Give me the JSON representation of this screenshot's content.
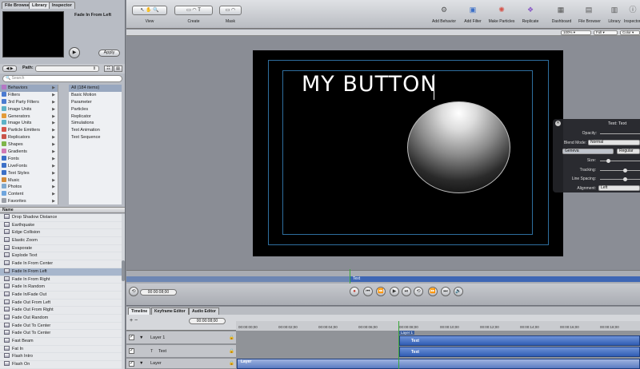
{
  "left_panel": {
    "tabs": [
      "File Browser",
      "Library",
      "Inspector"
    ],
    "preview_name": "Fade In From Left",
    "apply_label": "Apply",
    "path_label": "Path:",
    "nav_arrows": "◀ ▶",
    "path_select_arrow": "⇕",
    "view_buttons": [
      "☷",
      "▤"
    ],
    "search_placeholder": "Search",
    "categories": [
      {
        "label": "Behaviors",
        "color": "#b477c4"
      },
      {
        "label": "Filters",
        "color": "#4a7bd1"
      },
      {
        "label": "3rd Party Filters",
        "color": "#4a7bd1"
      },
      {
        "label": "Image Units",
        "color": "#5db2c7"
      },
      {
        "label": "Generators",
        "color": "#e39b3a"
      },
      {
        "label": "Image Units",
        "color": "#5db2c7"
      },
      {
        "label": "Particle Emitters",
        "color": "#d6544a"
      },
      {
        "label": "Replicators",
        "color": "#c9544a"
      },
      {
        "label": "Shapes",
        "color": "#7fb54a"
      },
      {
        "label": "Gradients",
        "color": "#d27ab5"
      },
      {
        "label": "Fonts",
        "color": "#3b6fc7"
      },
      {
        "label": "LiveFonts",
        "color": "#3b6fc7"
      },
      {
        "label": "Text Styles",
        "color": "#3b6fc7"
      },
      {
        "label": "Music",
        "color": "#d18a3a"
      },
      {
        "label": "Photos",
        "color": "#7fa9cf"
      },
      {
        "label": "Content",
        "color": "#6ea5dd"
      },
      {
        "label": "Favorites",
        "color": "#9a9ea6"
      }
    ],
    "subcategories": [
      "All (184 items)",
      "Basic Motion",
      "Parameter",
      "Particles",
      "Replicator",
      "Simulations",
      "Text Animation",
      "Text Sequence"
    ],
    "list_header": "Name",
    "items": [
      "Drop Shadow Distance",
      "Earthquake",
      "Edge Collision",
      "Elastic Zoom",
      "Evaporate",
      "Explode Text",
      "Fade In From Center",
      "Fade In From Left",
      "Fade In From Right",
      "Fade In Random",
      "Fade In/Fade Out",
      "Fade Out From Left",
      "Fade Out From Right",
      "Fade Out Random",
      "Fade Out To Center",
      "Fade Out To Center",
      "Fast Beam",
      "Fat In",
      "Flash Intro",
      "Flash On"
    ]
  },
  "toolbar": {
    "groups": [
      "View",
      "Create",
      "Mask"
    ],
    "actions": [
      "Add Behavior",
      "Add Filter",
      "Make Particles",
      "Replicate",
      "Dashboard",
      "File Browser",
      "Library",
      "Inspector"
    ],
    "view_tools": "↖ ✋ 🔍",
    "create_tools": "▭ ◠ T",
    "mask_tools": "▭ ◠",
    "action_icons": [
      "⚙",
      "▣",
      "✺",
      "❖"
    ],
    "panel_icons": [
      "▦",
      "▤",
      "▥",
      "ⓘ"
    ],
    "zoom": "100%",
    "resolution": "Full",
    "color_mode": "Color"
  },
  "canvas": {
    "headline": "MY BUTTON"
  },
  "hud": {
    "title": "Text: Text",
    "close_glyph": "✕",
    "opacity_label": "Opacity:",
    "blend_label": "Blend Mode:",
    "blend_value": "Normal",
    "font_value": "Geneva",
    "font_style": "Regular",
    "size_label": "Size:",
    "tracking_label": "Tracking:",
    "line_spacing_label": "Line Spacing:",
    "alignment_label": "Alignment:",
    "alignment_value": "Left"
  },
  "mini_timeline": {
    "clip_label": "Text"
  },
  "transport": {
    "timecode": "00:00:08;00",
    "buttons": [
      "●",
      "⏮",
      "⏪",
      "▶",
      "⏯",
      "⏩",
      "⏭",
      "⟲",
      "🔊"
    ]
  },
  "timeline": {
    "tabs": [
      "Timeline",
      "Keyframe Editor",
      "Audio Editor"
    ],
    "timecode": "00:00:08;00",
    "ruler": [
      "00:00:00;00",
      "00:00:02;00",
      "00:00:04;00",
      "00:00:06;00",
      "00:00:08;00",
      "00:00:10;00",
      "00:00:12;00",
      "00:00:14;00",
      "00:00:16;00",
      "00:00:18;00"
    ],
    "add_remove": "+ −",
    "check_glyph": "✓",
    "layers": [
      {
        "name": "Layer 1",
        "bar_title": "Layer 1",
        "bar_label": "Text"
      },
      {
        "name": "Text",
        "bar_label": "Text"
      },
      {
        "name": "Layer",
        "bar_label": "Layer"
      }
    ]
  }
}
